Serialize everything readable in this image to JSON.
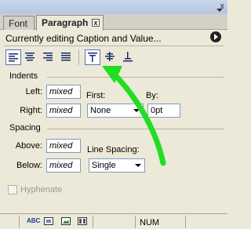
{
  "window": {
    "close_label": "x"
  },
  "tabs": [
    {
      "label": "Font",
      "active": false
    },
    {
      "label": "Paragraph",
      "active": true
    }
  ],
  "tab_close_label": "x",
  "status_text": "Currently editing Caption and Value...",
  "toolbar": {
    "buttons": [
      {
        "name": "align-left-icon",
        "selected": true
      },
      {
        "name": "align-center-icon",
        "selected": false
      },
      {
        "name": "align-right-icon",
        "selected": false
      },
      {
        "name": "justify-icon",
        "selected": false
      },
      {
        "name": "valign-top-icon",
        "selected": true
      },
      {
        "name": "valign-middle-icon",
        "selected": false
      },
      {
        "name": "valign-bottom-icon",
        "selected": false
      }
    ]
  },
  "indents": {
    "title": "Indents",
    "left_label": "Left:",
    "left_value": "mixed",
    "right_label": "Right:",
    "right_value": "mixed",
    "first_label": "First:",
    "first_value": "None",
    "by_label": "By:",
    "by_value": "0pt"
  },
  "spacing": {
    "title": "Spacing",
    "above_label": "Above:",
    "above_value": "mixed",
    "below_label": "Below:",
    "below_value": "mixed",
    "line_spacing_label": "Line Spacing:",
    "line_spacing_value": "Single"
  },
  "hyphenate_label": "Hyphenate",
  "statusbar": {
    "spell_icon_text": "ABC",
    "num_label": "NUM"
  },
  "colors": {
    "annotation_arrow": "#22dd22"
  }
}
